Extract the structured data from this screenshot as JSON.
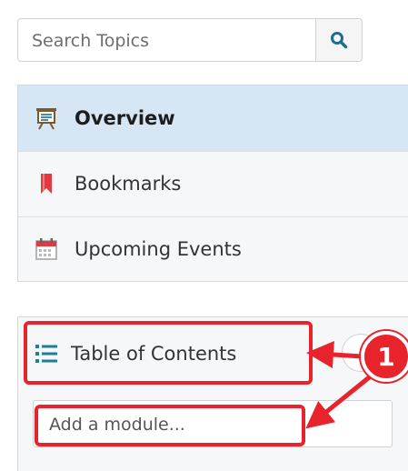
{
  "search": {
    "placeholder": "Search Topics",
    "icon": "magnifier-icon"
  },
  "nav": {
    "items": [
      {
        "label": "Overview",
        "icon": "presentation-board-icon",
        "active": true
      },
      {
        "label": "Bookmarks",
        "icon": "bookmark-icon",
        "active": false
      },
      {
        "label": "Upcoming Events",
        "icon": "calendar-icon",
        "active": false
      }
    ]
  },
  "toc": {
    "label": "Table of Contents",
    "icon": "list-icon"
  },
  "module_input": {
    "placeholder": "Add a module..."
  },
  "callout": {
    "number": "1"
  },
  "colors": {
    "highlight_red": "#e8232b",
    "active_blue": "#d6e6f5",
    "icon_teal": "#1d6f8f"
  }
}
